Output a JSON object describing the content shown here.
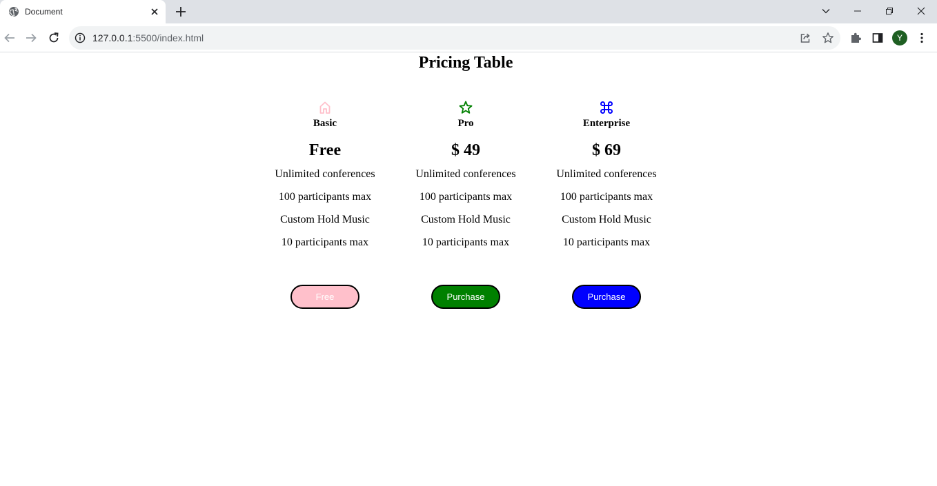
{
  "browser": {
    "tab_title": "Document",
    "url_host": "127.0.0.1",
    "url_rest": ":5500/index.html",
    "profile_initial": "Y"
  },
  "page": {
    "title": "Pricing Table",
    "plans": [
      {
        "name": "Basic",
        "icon": "home-icon",
        "color": "#ffc0cb",
        "price": "Free",
        "features": [
          "Unlimited conferences",
          "100 participants max",
          "Custom Hold Music",
          "10 participants max"
        ],
        "button_label": "Free"
      },
      {
        "name": "Pro",
        "icon": "star-icon",
        "color": "#008000",
        "price": "$ 49",
        "features": [
          "Unlimited conferences",
          "100 participants max",
          "Custom Hold Music",
          "10 participants max"
        ],
        "button_label": "Purchase"
      },
      {
        "name": "Enterprise",
        "icon": "command-icon",
        "color": "#0000ff",
        "price": "$ 69",
        "features": [
          "Unlimited conferences",
          "100 participants max",
          "Custom Hold Music",
          "10 participants max"
        ],
        "button_label": "Purchase"
      }
    ]
  }
}
